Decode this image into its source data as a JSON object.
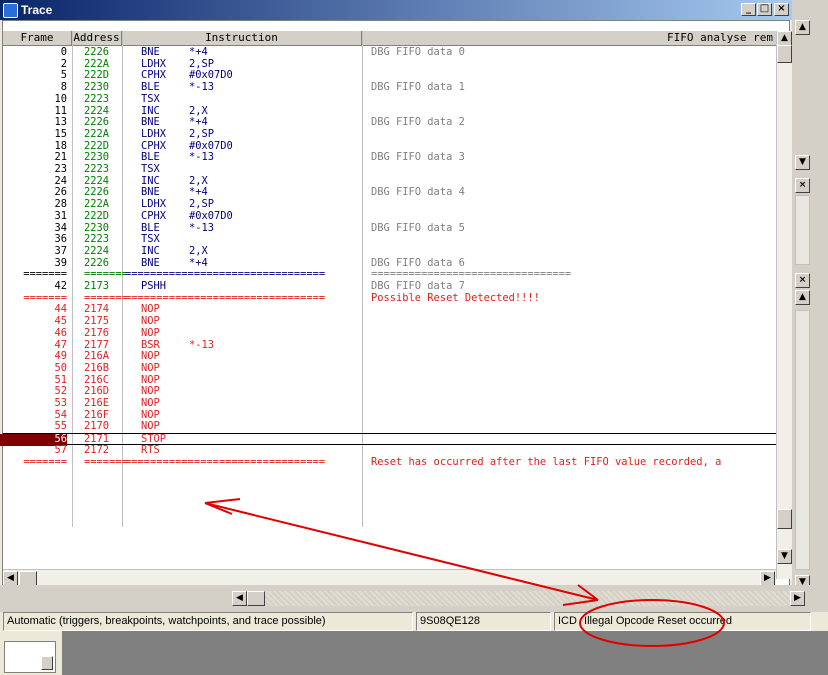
{
  "window": {
    "title": "Trace",
    "min_label": "_",
    "max_label": "□",
    "close_label": "×"
  },
  "columns": {
    "frame": "Frame",
    "address": "Address",
    "instruction": "Instruction",
    "fifo": "FIFO analyse rem"
  },
  "rows": [
    {
      "frame": "0",
      "addr": "2226",
      "mn": "BNE",
      "op": "*+4",
      "rem": "DBG FIFO data 0",
      "kind": "normal"
    },
    {
      "frame": "2",
      "addr": "222A",
      "mn": "LDHX",
      "op": "2,SP",
      "rem": "",
      "kind": "normal"
    },
    {
      "frame": "5",
      "addr": "222D",
      "mn": "CPHX",
      "op": "#0x07D0",
      "rem": "",
      "kind": "normal"
    },
    {
      "frame": "8",
      "addr": "2230",
      "mn": "BLE",
      "op": "*-13",
      "rem": "DBG FIFO data 1",
      "kind": "normal"
    },
    {
      "frame": "10",
      "addr": "2223",
      "mn": "TSX",
      "op": "",
      "rem": "",
      "kind": "normal"
    },
    {
      "frame": "11",
      "addr": "2224",
      "mn": "INC",
      "op": "2,X",
      "rem": "",
      "kind": "normal"
    },
    {
      "frame": "13",
      "addr": "2226",
      "mn": "BNE",
      "op": "*+4",
      "rem": "DBG FIFO data 2",
      "kind": "normal"
    },
    {
      "frame": "15",
      "addr": "222A",
      "mn": "LDHX",
      "op": "2,SP",
      "rem": "",
      "kind": "normal"
    },
    {
      "frame": "18",
      "addr": "222D",
      "mn": "CPHX",
      "op": "#0x07D0",
      "rem": "",
      "kind": "normal"
    },
    {
      "frame": "21",
      "addr": "2230",
      "mn": "BLE",
      "op": "*-13",
      "rem": "DBG FIFO data 3",
      "kind": "normal"
    },
    {
      "frame": "23",
      "addr": "2223",
      "mn": "TSX",
      "op": "",
      "rem": "",
      "kind": "normal"
    },
    {
      "frame": "24",
      "addr": "2224",
      "mn": "INC",
      "op": "2,X",
      "rem": "",
      "kind": "normal"
    },
    {
      "frame": "26",
      "addr": "2226",
      "mn": "BNE",
      "op": "*+4",
      "rem": "DBG FIFO data 4",
      "kind": "normal"
    },
    {
      "frame": "28",
      "addr": "222A",
      "mn": "LDHX",
      "op": "2,SP",
      "rem": "",
      "kind": "normal"
    },
    {
      "frame": "31",
      "addr": "222D",
      "mn": "CPHX",
      "op": "#0x07D0",
      "rem": "",
      "kind": "normal"
    },
    {
      "frame": "34",
      "addr": "2230",
      "mn": "BLE",
      "op": "*-13",
      "rem": "DBG FIFO data 5",
      "kind": "normal"
    },
    {
      "frame": "36",
      "addr": "2223",
      "mn": "TSX",
      "op": "",
      "rem": "",
      "kind": "normal"
    },
    {
      "frame": "37",
      "addr": "2224",
      "mn": "INC",
      "op": "2,X",
      "rem": "",
      "kind": "normal"
    },
    {
      "frame": "39",
      "addr": "2226",
      "mn": "BNE",
      "op": "*+4",
      "rem": "DBG FIFO data 6",
      "kind": "normal"
    },
    {
      "frame": "=======",
      "addr": "=======",
      "mn": "================================",
      "op": "",
      "rem": "================================",
      "kind": "sep"
    },
    {
      "frame": "42",
      "addr": "2173",
      "mn": "PSHH",
      "op": "",
      "rem": "DBG FIFO data 7",
      "kind": "normal"
    },
    {
      "frame": "=======",
      "addr": "=======",
      "mn": "================================",
      "op": "",
      "rem": "Possible Reset Detected!!!!",
      "kind": "sepred"
    },
    {
      "frame": "44",
      "addr": "2174",
      "mn": "NOP",
      "op": "",
      "rem": "",
      "kind": "red"
    },
    {
      "frame": "45",
      "addr": "2175",
      "mn": "NOP",
      "op": "",
      "rem": "",
      "kind": "red"
    },
    {
      "frame": "46",
      "addr": "2176",
      "mn": "NOP",
      "op": "",
      "rem": "",
      "kind": "red"
    },
    {
      "frame": "47",
      "addr": "2177",
      "mn": "BSR",
      "op": "*-13",
      "rem": "",
      "kind": "red"
    },
    {
      "frame": "49",
      "addr": "216A",
      "mn": "NOP",
      "op": "",
      "rem": "",
      "kind": "red"
    },
    {
      "frame": "50",
      "addr": "216B",
      "mn": "NOP",
      "op": "",
      "rem": "",
      "kind": "red"
    },
    {
      "frame": "51",
      "addr": "216C",
      "mn": "NOP",
      "op": "",
      "rem": "",
      "kind": "red"
    },
    {
      "frame": "52",
      "addr": "216D",
      "mn": "NOP",
      "op": "",
      "rem": "",
      "kind": "red"
    },
    {
      "frame": "53",
      "addr": "216E",
      "mn": "NOP",
      "op": "",
      "rem": "",
      "kind": "red"
    },
    {
      "frame": "54",
      "addr": "216F",
      "mn": "NOP",
      "op": "",
      "rem": "",
      "kind": "red"
    },
    {
      "frame": "55",
      "addr": "2170",
      "mn": "NOP",
      "op": "",
      "rem": "",
      "kind": "red"
    },
    {
      "frame": "56",
      "addr": "2171",
      "mn": "STOP",
      "op": "",
      "rem": "",
      "kind": "selected"
    },
    {
      "frame": "57",
      "addr": "2172",
      "mn": "RTS",
      "op": "",
      "rem": "",
      "kind": "red"
    },
    {
      "frame": "=======",
      "addr": "=======",
      "mn": "================================",
      "op": "",
      "rem": "Reset has occurred after the last FIFO value recorded, a",
      "kind": "sepred"
    }
  ],
  "status": {
    "mode": "Automatic (triggers, breakpoints, watchpoints, and trace possible)",
    "device": "9S08QE128",
    "connection": "ICD",
    "message": "Illegal Opcode Reset occurred"
  },
  "colors": {
    "address": "#008000",
    "instruction": "#000080",
    "remark": "#808080",
    "red": "#e02020",
    "selected_bg": "#800000",
    "annotation": "#e00000"
  },
  "icons": [
    "trace-window-icon",
    "minimize-icon",
    "maximize-icon",
    "close-icon",
    "scroll-up-arrow",
    "scroll-down-arrow",
    "scroll-left-arrow",
    "scroll-right-arrow"
  ]
}
